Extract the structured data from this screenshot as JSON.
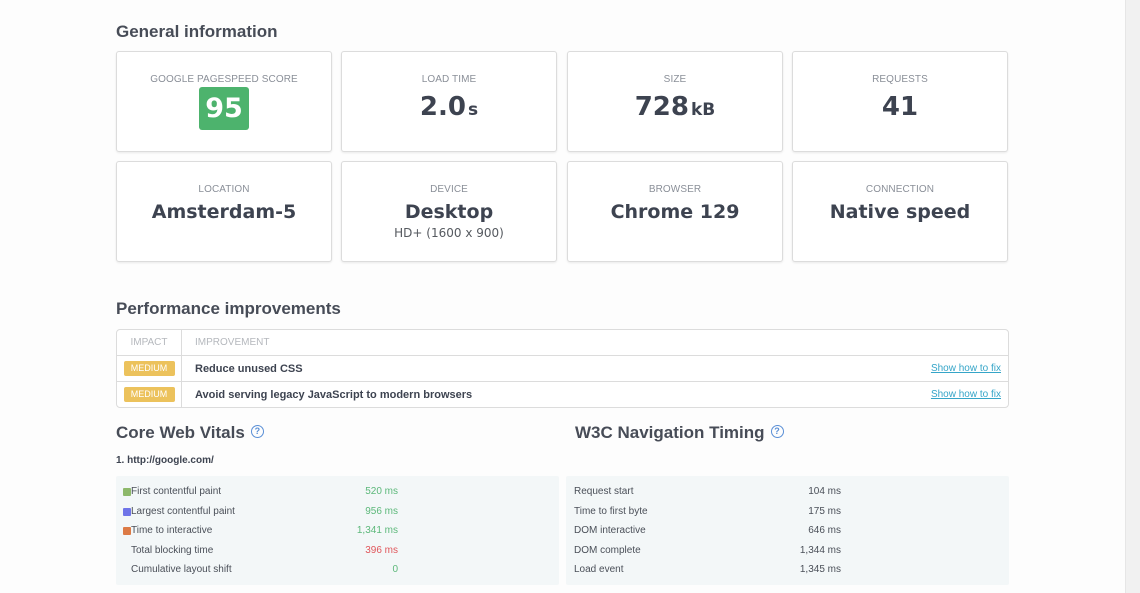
{
  "general": {
    "title": "General information",
    "cards": [
      {
        "label": "Google PageSpeed Score",
        "value": "95",
        "badge_color": "#4db36d"
      },
      {
        "label": "Load time",
        "value": "2.0",
        "unit": "s"
      },
      {
        "label": "Size",
        "value": "728",
        "unit": "kB"
      },
      {
        "label": "Requests",
        "value": "41"
      },
      {
        "label": "Location",
        "value": "Amsterdam-5"
      },
      {
        "label": "Device",
        "value": "Desktop",
        "sub": "HD+ (1600 x 900)"
      },
      {
        "label": "Browser",
        "value": "Chrome 129"
      },
      {
        "label": "Connection",
        "value": "Native speed"
      }
    ]
  },
  "performance": {
    "title": "Performance improvements",
    "columns": {
      "impact": "IMPACT",
      "improvement": "IMPROVEMENT"
    },
    "rows": [
      {
        "impact": "MEDIUM",
        "improvement": "Reduce unused CSS",
        "link": "Show how to fix"
      },
      {
        "impact": "MEDIUM",
        "improvement": "Avoid serving legacy JavaScript to modern browsers",
        "link": "Show how to fix"
      }
    ],
    "badge_color": "#ecc25c",
    "link_color": "#35a5c8"
  },
  "core_web_vitals": {
    "title": "Core Web Vitals",
    "help_icon": "?",
    "url": "1. http://google.com/",
    "metrics": [
      {
        "label": "First contentful paint",
        "value": "520 ms",
        "swatch": "#8db86a",
        "value_color": "#5cb87a"
      },
      {
        "label": "Largest contentful paint",
        "value": "956 ms",
        "swatch": "#6f74e8",
        "value_color": "#5cb87a"
      },
      {
        "label": "Time to interactive",
        "value": "1,341 ms",
        "swatch": "#dc7a45",
        "value_color": "#5cb87a"
      },
      {
        "label": "Total blocking time",
        "value": "396 ms",
        "value_color": "#e0565b"
      },
      {
        "label": "Cumulative layout shift",
        "value": "0",
        "value_color": "#5cb87a"
      }
    ]
  },
  "w3c_timing": {
    "title": "W3C Navigation Timing",
    "help_icon": "?",
    "metrics": [
      {
        "label": "Request start",
        "value": "104 ms"
      },
      {
        "label": "Time to first byte",
        "value": "175 ms"
      },
      {
        "label": "DOM interactive",
        "value": "646 ms"
      },
      {
        "label": "DOM complete",
        "value": "1,344 ms"
      },
      {
        "label": "Load event",
        "value": "1,345 ms"
      }
    ]
  }
}
